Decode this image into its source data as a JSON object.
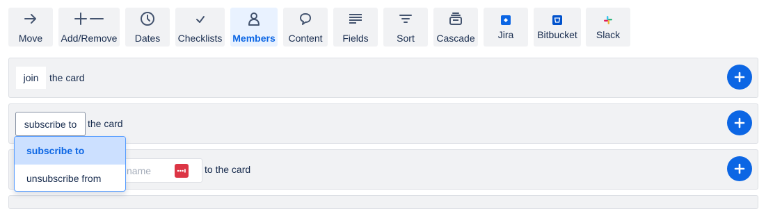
{
  "toolbar": {
    "buttons": [
      {
        "label": "Move",
        "icon": "arrow-right-icon"
      },
      {
        "label": "Add/Remove",
        "icon": "plus-minus-icon"
      },
      {
        "label": "Dates",
        "icon": "clock-icon"
      },
      {
        "label": "Checklists",
        "icon": "checkmark-icon"
      },
      {
        "label": "Members",
        "icon": "person-icon",
        "active": true
      },
      {
        "label": "Content",
        "icon": "speech-bubble-icon"
      },
      {
        "label": "Fields",
        "icon": "lines-icon"
      },
      {
        "label": "Sort",
        "icon": "sort-icon"
      },
      {
        "label": "Cascade",
        "icon": "stack-icon"
      },
      {
        "label": "Jira",
        "icon": "jira-logo-icon"
      },
      {
        "label": "Bitbucket",
        "icon": "bitbucket-logo-icon"
      },
      {
        "label": "Slack",
        "icon": "slack-logo-icon"
      }
    ]
  },
  "rows": [
    {
      "select": "join",
      "text": "the card"
    },
    {
      "select": "subscribe to",
      "text": "the card"
    },
    {
      "input_placeholder": "name",
      "text": "to the card"
    }
  ],
  "dropdown": {
    "options": [
      "subscribe to",
      "unsubscribe from"
    ],
    "selected": "subscribe to"
  },
  "colors": {
    "accent": "#0c66e4",
    "row_bg": "#f1f2f4",
    "active_bg": "#e9f2ff",
    "password_icon": "#dc3545"
  }
}
